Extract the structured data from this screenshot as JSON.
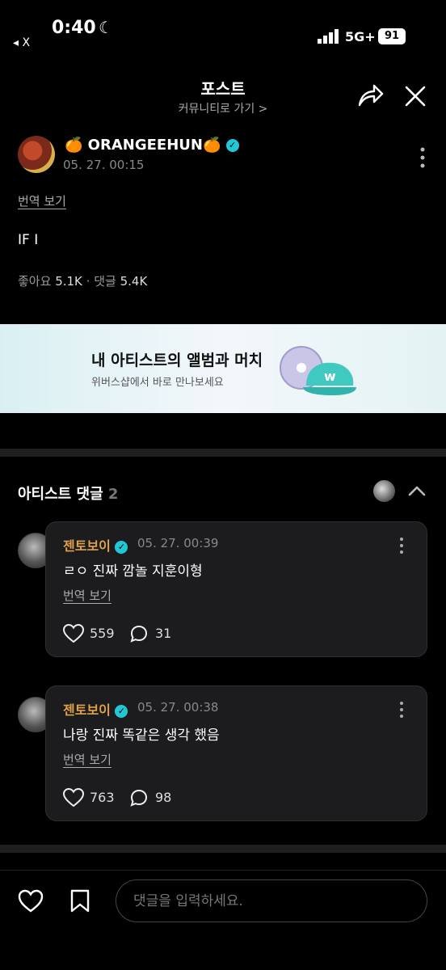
{
  "status_bar": {
    "time": "0:40",
    "back_app": "◂ X",
    "network": "5G+",
    "battery": "91"
  },
  "header": {
    "title": "포스트",
    "community_link": "커뮤니티로 가기 >"
  },
  "post": {
    "author": "🍊 ORANGEEHUN🍊",
    "timestamp": "05. 27. 00:15",
    "translate_label": "번역 보기",
    "body": "IF I",
    "likes_label": "좋아요",
    "likes_count": "5.1K",
    "comments_label": "댓글",
    "comments_count": "5.4K"
  },
  "banner": {
    "title": "내 아티스트의 앨범과 머치",
    "subtitle": "위버스샵에서 바로 만나보세요"
  },
  "artist_comments": {
    "title": "아티스트 댓글",
    "count": "2",
    "items": [
      {
        "author": "젠토보이",
        "timestamp": "05. 27. 00:39",
        "text": "ㄹㅇ 진짜 깜놀 지훈이형",
        "translate_label": "번역 보기",
        "likes": "559",
        "replies": "31"
      },
      {
        "author": "젠토보이",
        "timestamp": "05. 27. 00:38",
        "text": "나랑 진짜 똑같은 생각 했음",
        "translate_label": "번역 보기",
        "likes": "763",
        "replies": "98"
      }
    ]
  },
  "bottom_bar": {
    "input_placeholder": "댓글을 입력하세요."
  },
  "colors": {
    "verified": "#22c7d6",
    "comment_author": "#e0a14a",
    "card_bg": "#1c1c1e"
  }
}
